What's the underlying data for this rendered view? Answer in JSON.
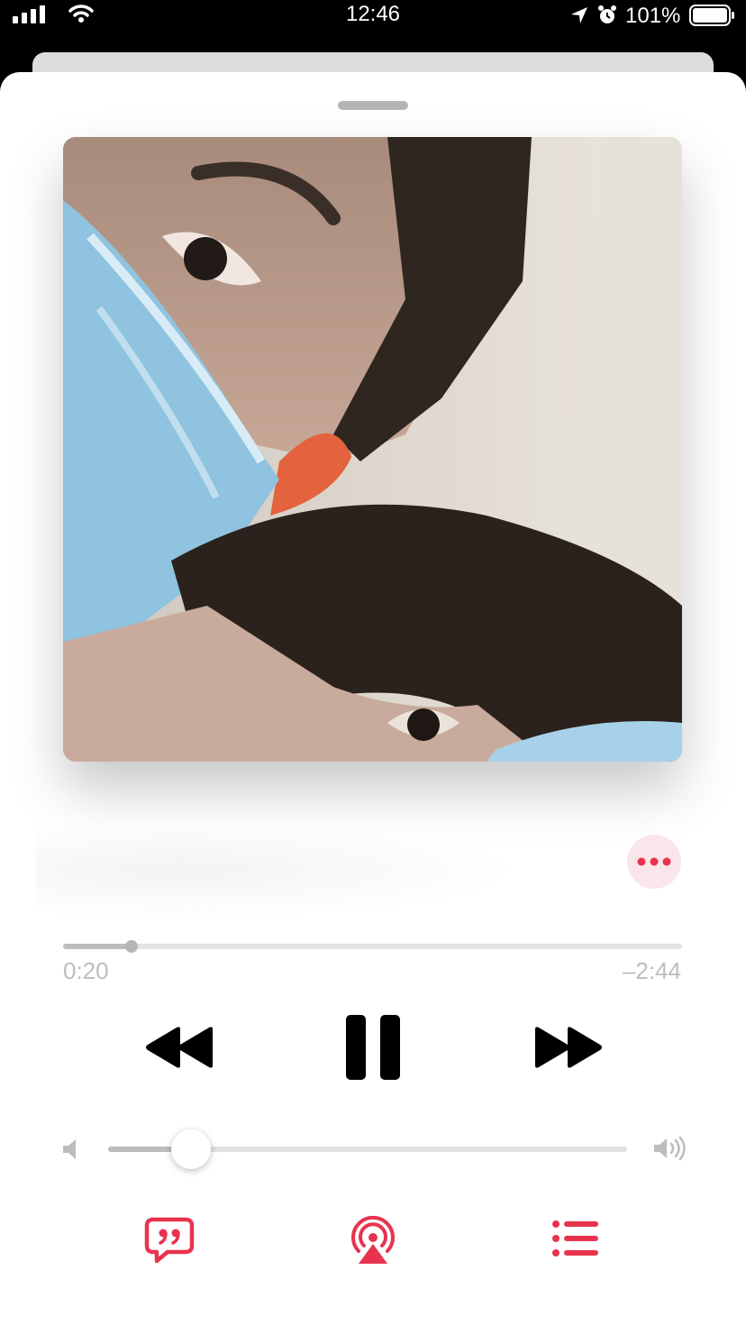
{
  "status_bar": {
    "time": "12:46",
    "battery": "101%",
    "icons": [
      "signal-icon",
      "wifi-icon",
      "location-icon",
      "alarm-icon",
      "battery-icon"
    ]
  },
  "player": {
    "artwork": "album-artwork",
    "progress": {
      "elapsed": "0:20",
      "remaining": "–2:44",
      "fraction": 0.11
    },
    "volume": {
      "fraction": 0.16
    },
    "state": "playing",
    "accent_color": "#e8334f",
    "icons": [
      "more-icon",
      "rewind-icon",
      "pause-icon",
      "fast-forward-icon",
      "volume-min-icon",
      "volume-max-icon",
      "lyrics-icon",
      "airplay-icon",
      "queue-icon"
    ]
  }
}
